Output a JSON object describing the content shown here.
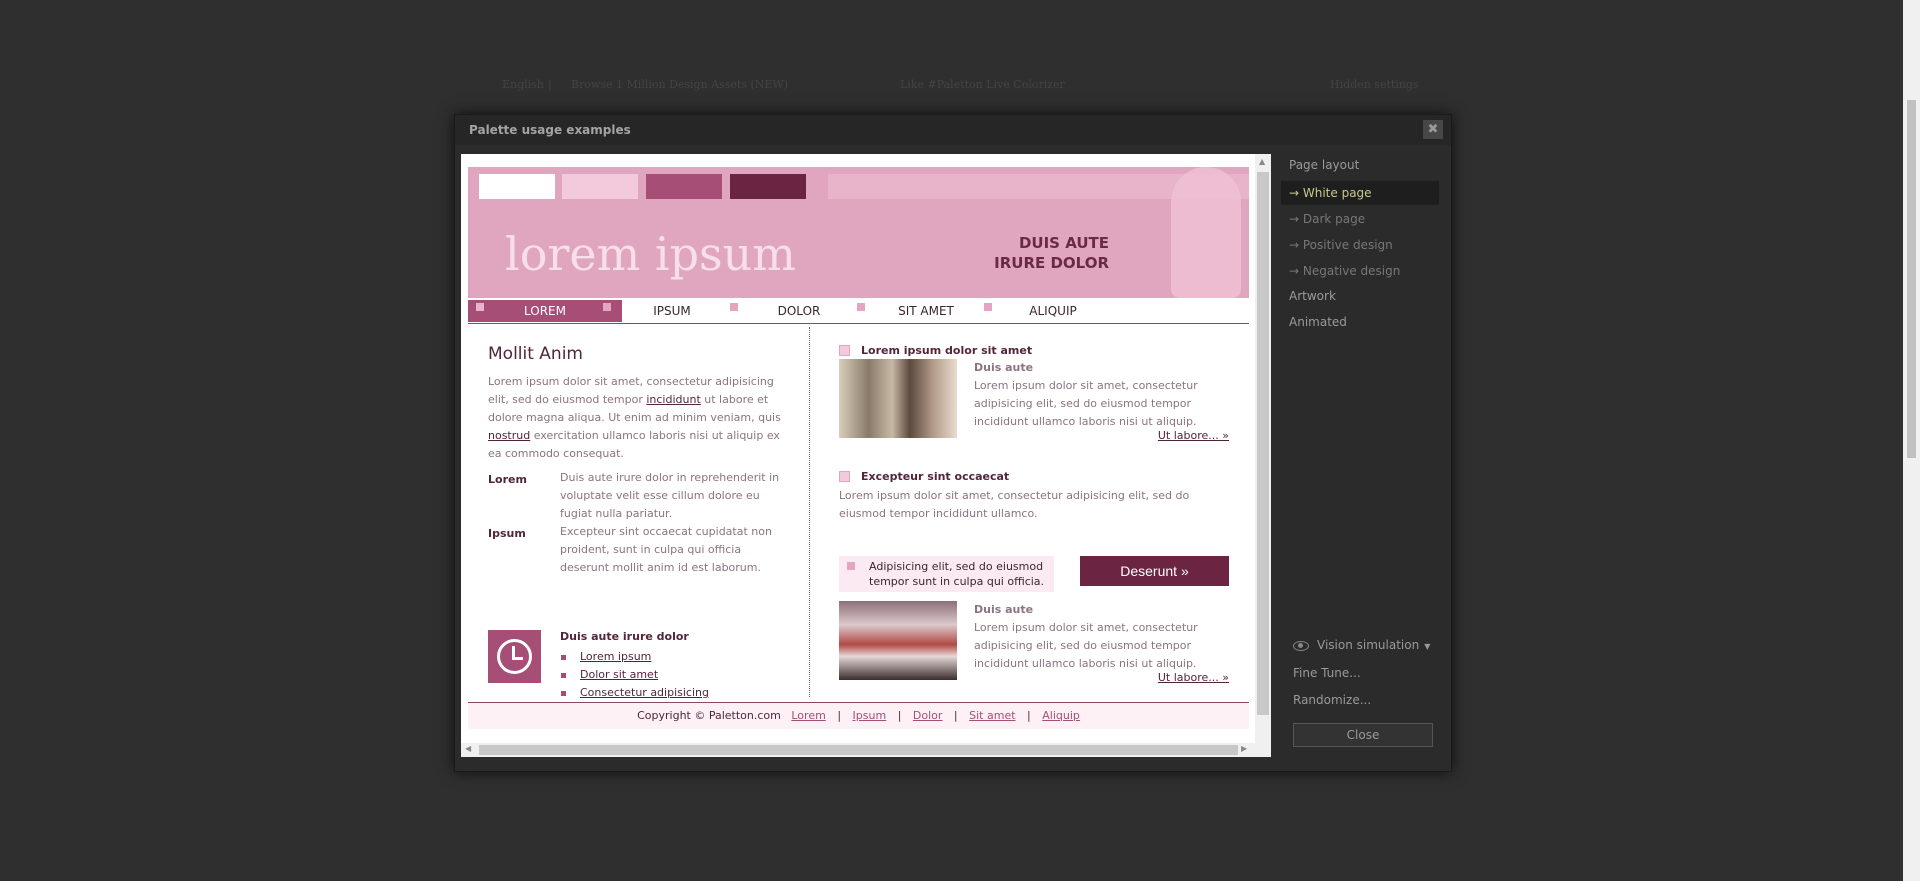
{
  "background_bar": {
    "language": "English",
    "sep": "|",
    "browse": "Browse 1 Million Design Assets (NEW)",
    "like": "Like #Paletton Live Colorizer",
    "settings": "Hidden settings"
  },
  "dialog": {
    "title": "Palette usage examples",
    "close_glyph": "✖"
  },
  "preview": {
    "swatches": [
      "#ffffff",
      "#f2cadb",
      "#a64e76",
      "#6b2442"
    ],
    "brand": "lorem ipsum",
    "slogan_line1": "DUIS AUTE",
    "slogan_line2": "IRURE DOLOR",
    "nav": [
      "LOREM",
      "IPSUM",
      "DOLOR",
      "SIT AMET",
      "ALIQUIP"
    ],
    "left": {
      "heading": "Mollit Anim",
      "p_a": "Lorem ipsum dolor sit amet, consectetur adipisicing elit, sed do eiusmod tempor ",
      "p_link1": "incididunt",
      "p_b": " ut labore et dolore magna aliqua. Ut enim ad minim veniam, quis ",
      "p_link2": "nostrud",
      "p_c": " exercitation ullamco laboris nisi ut aliquip ex ea commodo consequat.",
      "def1_label": "Lorem",
      "def1_text": "Duis aute irure dolor in reprehenderit in voluptate velit esse cillum dolore eu fugiat nulla pariatur.",
      "def2_label": "Ipsum",
      "def2_text": "Excepteur sint occaecat cupidatat non proident, sunt in culpa qui officia deserunt mollit anim id est laborum.",
      "list_title": "Duis aute irure dolor",
      "list": [
        "Lorem ipsum",
        "Dolor sit amet",
        "Consectetur adipisicing"
      ]
    },
    "right": {
      "h1": "Lorem ipsum dolor sit amet",
      "sub1": "Duis aute",
      "text1": "Lorem ipsum dolor sit amet, consectetur adipisicing elit, sed do eiusmod tempor incididunt ullamco laboris nisi ut aliquip.",
      "more1": "Ut labore... »",
      "h2": "Excepteur sint occaecat",
      "text2": "Lorem ipsum dolor sit amet, consectetur adipisicing elit, sed do eiusmod tempor incididunt ullamco.",
      "callout": "Adipisicing elit, sed do eiusmod tempor sunt in culpa qui officia.",
      "button": "Deserunt »",
      "sub2": "Duis aute",
      "text3": "Lorem ipsum dolor sit amet, consectetur adipisicing elit, sed do eiusmod tempor incididunt ullamco laboris nisi ut aliquip.",
      "more2": "Ut labore... »"
    },
    "footer": {
      "copyright": "Copyright © Paletton.com",
      "sep": "|",
      "links": [
        "Lorem",
        "Ipsum",
        "Dolor",
        "Sit amet",
        "Aliquip"
      ]
    }
  },
  "sidebar": {
    "page_layout": "Page layout",
    "white_page": "→ White page",
    "dark_page": "→ Dark page",
    "positive_design": "→ Positive design",
    "negative_design": "→ Negative design",
    "artwork": "Artwork",
    "animated": "Animated",
    "vision": "Vision simulation",
    "fine_tune": "Fine Tune...",
    "randomize": "Randomize...",
    "close": "Close"
  },
  "colors": {
    "page_bg": "#2f2f2f",
    "banner": "#e1a6bf",
    "accent": "#a64e76",
    "dark_accent": "#6b2442",
    "selected_sidebar_text": "#c9c98a"
  }
}
